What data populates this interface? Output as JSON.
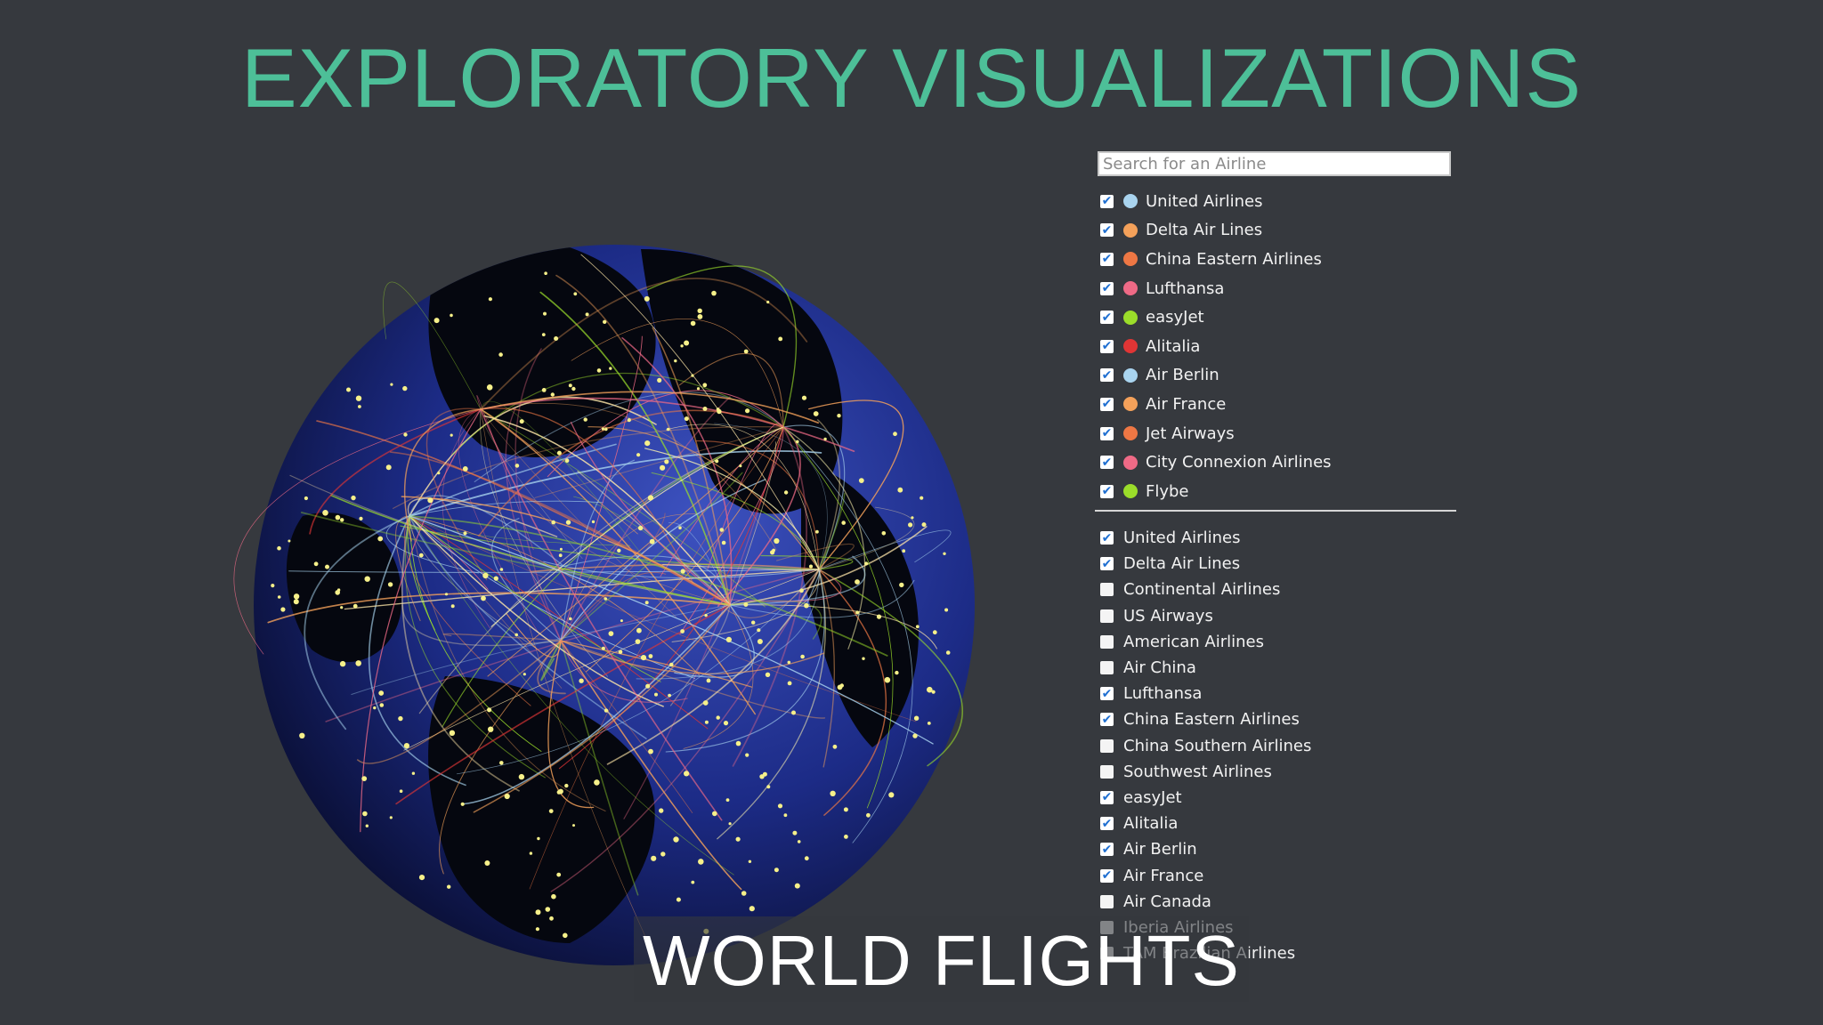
{
  "title": "EXPLORATORY VISUALIZATIONS",
  "subtitle": "WORLD FLIGHTS",
  "search": {
    "placeholder": "Search for an Airline",
    "value": ""
  },
  "legend": [
    {
      "label": "United Airlines",
      "color": "#a9d4ef",
      "checked": true
    },
    {
      "label": "Delta Air Lines",
      "color": "#f4a15a",
      "checked": true
    },
    {
      "label": "China Eastern Airlines",
      "color": "#ee7744",
      "checked": true
    },
    {
      "label": "Lufthansa",
      "color": "#ef6a86",
      "checked": true
    },
    {
      "label": "easyJet",
      "color": "#9bdd2a",
      "checked": true
    },
    {
      "label": "Alitalia",
      "color": "#e03535",
      "checked": true
    },
    {
      "label": "Air Berlin",
      "color": "#a9d4ef",
      "checked": true
    },
    {
      "label": "Air France",
      "color": "#f4a15a",
      "checked": true
    },
    {
      "label": "Jet Airways",
      "color": "#ee7744",
      "checked": true
    },
    {
      "label": "City Connexion Airlines",
      "color": "#ef6a86",
      "checked": true
    },
    {
      "label": "Flybe",
      "color": "#9bdd2a",
      "checked": true
    }
  ],
  "filters": [
    {
      "label": "United Airlines",
      "checked": true
    },
    {
      "label": "Delta Air Lines",
      "checked": true
    },
    {
      "label": "Continental Airlines",
      "checked": false
    },
    {
      "label": "US Airways",
      "checked": false
    },
    {
      "label": "American Airlines",
      "checked": false
    },
    {
      "label": "Air China",
      "checked": false
    },
    {
      "label": "Lufthansa",
      "checked": true
    },
    {
      "label": "China Eastern Airlines",
      "checked": true
    },
    {
      "label": "China Southern Airlines",
      "checked": false
    },
    {
      "label": "Southwest Airlines",
      "checked": false
    },
    {
      "label": "easyJet",
      "checked": true
    },
    {
      "label": "Alitalia",
      "checked": true
    },
    {
      "label": "Air Berlin",
      "checked": true
    },
    {
      "label": "Air France",
      "checked": true
    },
    {
      "label": "Air Canada",
      "checked": false
    },
    {
      "label": "Iberia Airlines",
      "checked": false
    },
    {
      "label": "TAM Brazilian Airlines",
      "checked": false
    }
  ],
  "colors": {
    "background": "#36393e",
    "title": "#4dbf98",
    "ocean": "#1b2a78",
    "land": "#05070f",
    "airport": "#f6f08a"
  }
}
